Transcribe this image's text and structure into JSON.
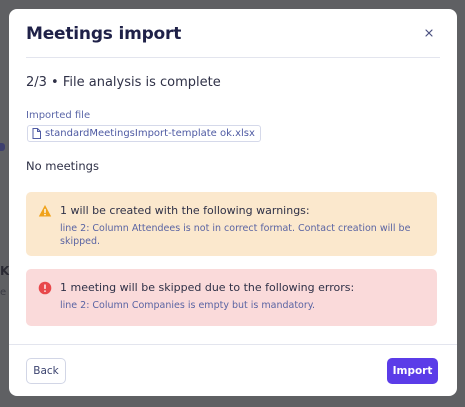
{
  "background": {
    "fragment_k": "K",
    "fragment_e": "e"
  },
  "modal": {
    "title": "Meetings import",
    "close_icon": "close-icon",
    "step_text": "2/3 • File analysis is complete",
    "imported_file_label": "Imported file",
    "file_name": "standardMeetingsImport-template ok.xlsx",
    "file_icon": "file-icon",
    "no_meetings_text": "No meetings"
  },
  "warning_alert": {
    "icon": "warning-triangle-icon",
    "title": "1 will be created with the following warnings:",
    "body": "line 2: Column Attendees is not in correct format. Contact creation will be skipped.",
    "color": "#fbe8cd",
    "icon_color": "#f0a21a"
  },
  "error_alert": {
    "icon": "error-circle-icon",
    "title": "1 meeting will be skipped due to the following errors:",
    "body": "line 2: Column Companies is empty but is mandatory.",
    "color": "#fadada",
    "icon_color": "#e8484b"
  },
  "footer": {
    "back_label": "Back",
    "import_label": "Import",
    "accent_color": "#5b3ce8"
  }
}
